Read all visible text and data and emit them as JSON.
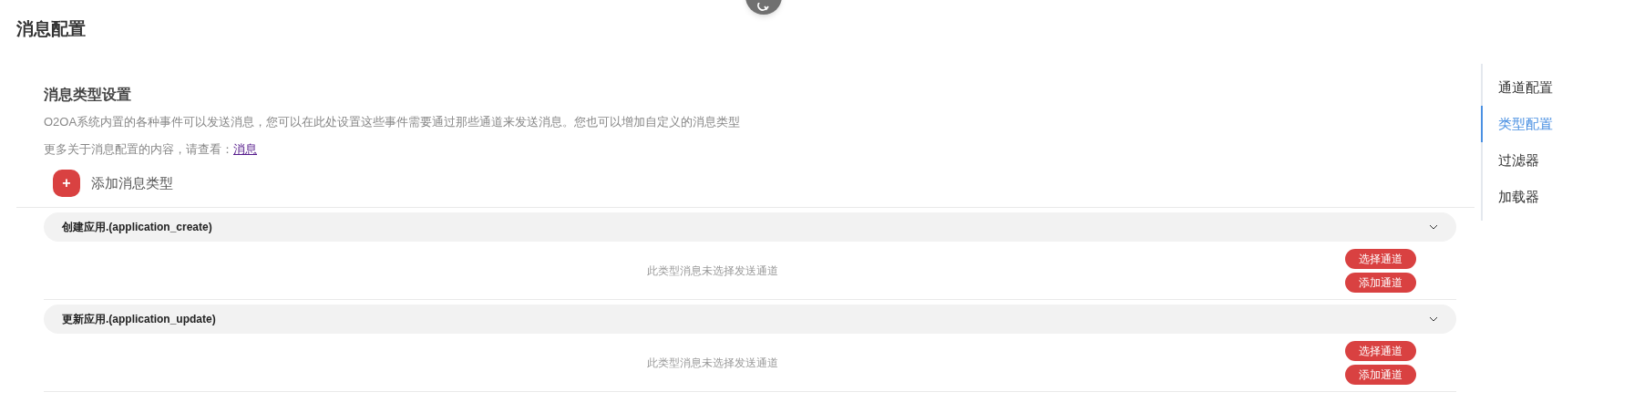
{
  "page": {
    "title": "消息配置"
  },
  "section": {
    "title": "消息类型设置",
    "description": "O2OA系统内置的各种事件可以发送消息，您可以在此处设置这些事件需要通过那些通道来发送消息。您也可以增加自定义的消息类型",
    "more_text": "更多关于消息配置的内容，请查看：",
    "more_link": "消息",
    "add_button": "添加消息类型",
    "add_icon": "+"
  },
  "types": [
    {
      "title": "创建应用.(application_create)",
      "expanded": true,
      "empty_text": "此类型消息未选择发送通道",
      "buttons": [
        "选择通道",
        "添加通道"
      ]
    },
    {
      "title": "更新应用.(application_update)",
      "expanded": true,
      "empty_text": "此类型消息未选择发送通道",
      "buttons": [
        "选择通道",
        "添加通道"
      ]
    }
  ],
  "nav": [
    {
      "label": "通道配置",
      "selected": false
    },
    {
      "label": "类型配置",
      "selected": true
    },
    {
      "label": "过滤器",
      "selected": false
    },
    {
      "label": "加载器",
      "selected": false
    }
  ]
}
